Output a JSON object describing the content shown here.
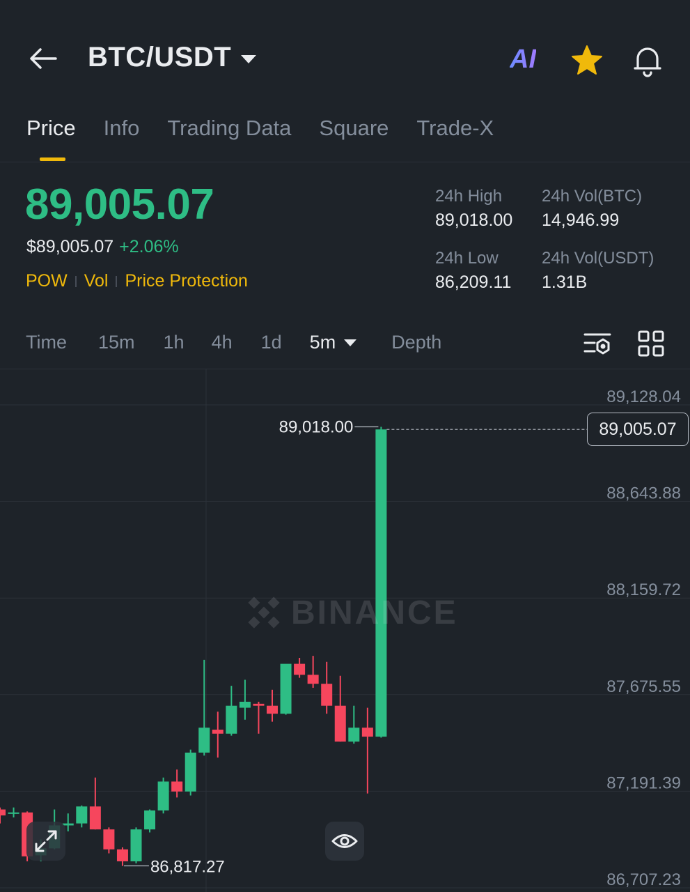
{
  "header": {
    "pair": "BTC/USDT",
    "ai_label": "AI"
  },
  "tabs": [
    {
      "label": "Price",
      "active": true
    },
    {
      "label": "Info"
    },
    {
      "label": "Trading Data"
    },
    {
      "label": "Square"
    },
    {
      "label": "Trade-X"
    }
  ],
  "ticker": {
    "last_price": "89,005.07",
    "usd_price": "$89,005.07",
    "change_pct": "+2.06%",
    "tags": [
      "POW",
      "Vol",
      "Price Protection"
    ],
    "stats": {
      "high_label": "24h High",
      "high_value": "89,018.00",
      "vol_btc_label": "24h Vol(BTC)",
      "vol_btc_value": "14,946.99",
      "low_label": "24h Low",
      "low_value": "86,209.11",
      "vol_usdt_label": "24h Vol(USDT)",
      "vol_usdt_value": "1.31B"
    }
  },
  "intervals": {
    "items": [
      "Time",
      "15m",
      "1h",
      "4h",
      "1d"
    ],
    "selected": "5m",
    "depth": "Depth"
  },
  "chart": {
    "watermark": "BINANCE",
    "current_price_label": "89,005.07",
    "high_marker": "89,018.00",
    "low_marker": "86,817.27"
  },
  "colors": {
    "up": "#2ebd85",
    "down": "#f6465d",
    "accent": "#f0b90b",
    "background": "#1e2329"
  },
  "chart_data": {
    "type": "candlestick",
    "interval": "5m",
    "y_ticks": [
      89128.04,
      88643.88,
      88159.72,
      87675.55,
      87191.39,
      86707.23
    ],
    "ylim": [
      86707.23,
      89128.04
    ],
    "current_price": 89005.07,
    "high_marker": 89018.0,
    "low_marker": 86817.27,
    "candles": [
      {
        "o": 87100,
        "h": 87110,
        "l": 87030,
        "c": 87070
      },
      {
        "o": 87080,
        "h": 87110,
        "l": 87060,
        "c": 87085
      },
      {
        "o": 87085,
        "h": 87090,
        "l": 86840,
        "c": 86865
      },
      {
        "o": 86870,
        "h": 86950,
        "l": 86840,
        "c": 86905
      },
      {
        "o": 86905,
        "h": 87100,
        "l": 86900,
        "c": 87020
      },
      {
        "o": 87020,
        "h": 87080,
        "l": 86990,
        "c": 87030
      },
      {
        "o": 87030,
        "h": 87120,
        "l": 87010,
        "c": 87115
      },
      {
        "o": 87115,
        "h": 87260,
        "l": 87000,
        "c": 87000
      },
      {
        "o": 87000,
        "h": 87010,
        "l": 86880,
        "c": 86900
      },
      {
        "o": 86900,
        "h": 86910,
        "l": 86817,
        "c": 86840
      },
      {
        "o": 86840,
        "h": 87010,
        "l": 86830,
        "c": 87000
      },
      {
        "o": 87000,
        "h": 87100,
        "l": 86985,
        "c": 87095
      },
      {
        "o": 87095,
        "h": 87260,
        "l": 87080,
        "c": 87240
      },
      {
        "o": 87240,
        "h": 87300,
        "l": 87160,
        "c": 87190
      },
      {
        "o": 87190,
        "h": 87400,
        "l": 87170,
        "c": 87385
      },
      {
        "o": 87385,
        "h": 87850,
        "l": 87370,
        "c": 87510
      },
      {
        "o": 87500,
        "h": 87590,
        "l": 87360,
        "c": 87480
      },
      {
        "o": 87480,
        "h": 87720,
        "l": 87470,
        "c": 87620
      },
      {
        "o": 87610,
        "h": 87750,
        "l": 87550,
        "c": 87640
      },
      {
        "o": 87630,
        "h": 87640,
        "l": 87480,
        "c": 87620
      },
      {
        "o": 87620,
        "h": 87700,
        "l": 87540,
        "c": 87580
      },
      {
        "o": 87580,
        "h": 87740,
        "l": 87575,
        "c": 87830
      },
      {
        "o": 87830,
        "h": 87860,
        "l": 87760,
        "c": 87775
      },
      {
        "o": 87775,
        "h": 87870,
        "l": 87710,
        "c": 87730
      },
      {
        "o": 87730,
        "h": 87840,
        "l": 87580,
        "c": 87620
      },
      {
        "o": 87620,
        "h": 87770,
        "l": 87440,
        "c": 87440
      },
      {
        "o": 87440,
        "h": 87620,
        "l": 87430,
        "c": 87510
      },
      {
        "o": 87510,
        "h": 87610,
        "l": 87180,
        "c": 87465
      },
      {
        "o": 87465,
        "h": 89018,
        "l": 87460,
        "c": 89005.07
      }
    ]
  }
}
